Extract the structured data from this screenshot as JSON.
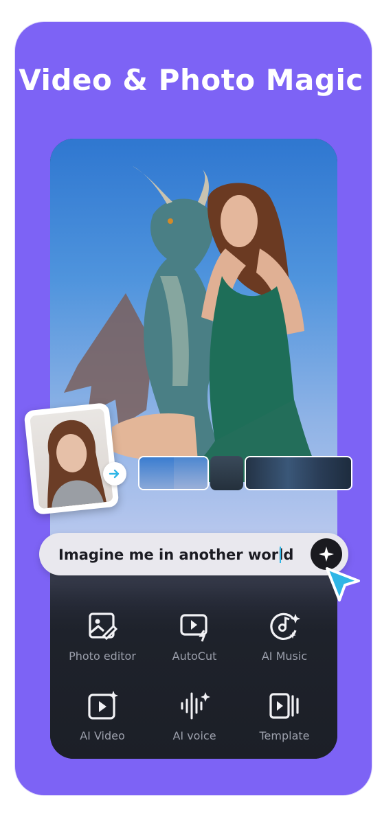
{
  "headline": "Video & Photo Magic",
  "prompt": {
    "text": "Imagine me in another world"
  },
  "tools": [
    {
      "label": "Photo editor",
      "icon": "photo-edit-icon"
    },
    {
      "label": "AutoCut",
      "icon": "autocut-icon"
    },
    {
      "label": "AI Music",
      "icon": "ai-music-icon"
    },
    {
      "label": "AI Video",
      "icon": "ai-video-icon"
    },
    {
      "label": "AI voice",
      "icon": "ai-voice-icon"
    },
    {
      "label": "Template",
      "icon": "template-icon"
    }
  ],
  "colors": {
    "card": "#7d63f5",
    "panel": "#1e222b",
    "accent": "#2fb6e6"
  }
}
